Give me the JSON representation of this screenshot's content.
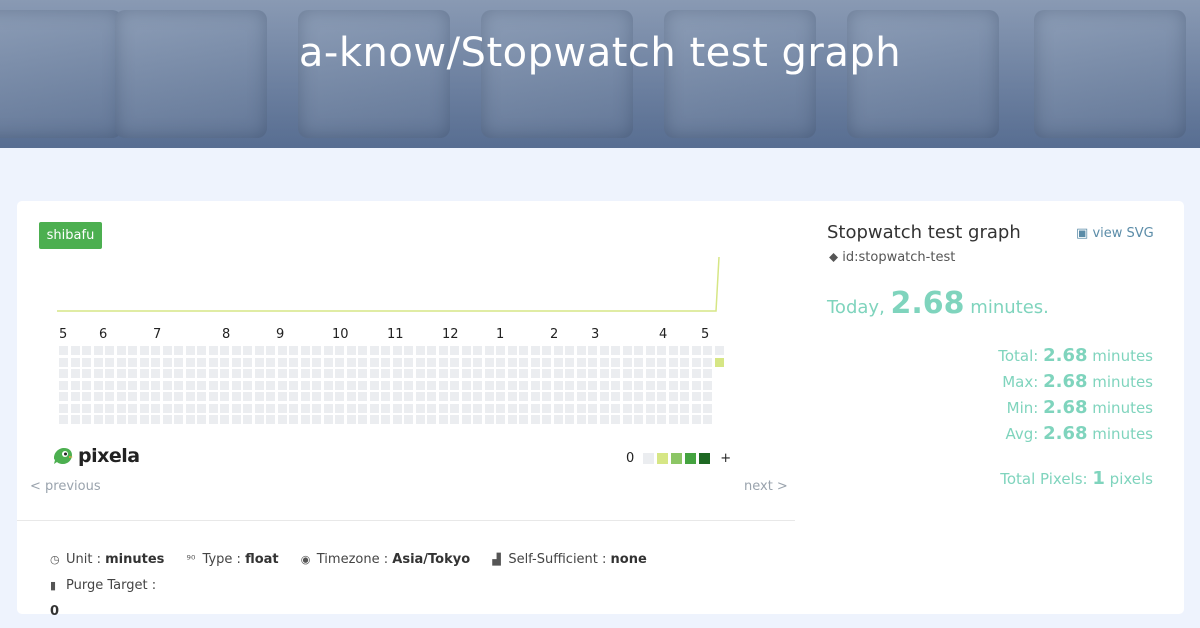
{
  "header": {
    "title": "a-know/Stopwatch test graph"
  },
  "graph": {
    "tag": "shibafu",
    "months": [
      "5",
      "6",
      "7",
      "8",
      "9",
      "10",
      "11",
      "12",
      "1",
      "2",
      "3",
      "4",
      "5"
    ],
    "legend": {
      "min_label": "0",
      "max_label": "+",
      "colors": [
        "#ebedf0",
        "#d6e685",
        "#8cc665",
        "#44a340",
        "#1e6823"
      ]
    },
    "active_color": "#d6e685",
    "logo_text": "pixela"
  },
  "pager": {
    "previous": "< previous",
    "next": "next >"
  },
  "meta": {
    "unit_label": "Unit",
    "unit_value": "minutes",
    "type_label": "Type",
    "type_value": "float",
    "timezone_label": "Timezone",
    "timezone_value": "Asia/Tokyo",
    "selfsufficient_label": "Self-Sufficient",
    "selfsufficient_value": "none",
    "purge_label": "Purge Target",
    "purge_value": "0"
  },
  "sidebar": {
    "title": "Stopwatch test graph",
    "view_svg": "view SVG",
    "graph_id": "id:stopwatch-test",
    "today_label": "Today",
    "today_value": "2.68",
    "today_unit": "minutes.",
    "stats": [
      {
        "label": "Total",
        "value": "2.68",
        "unit": "minutes"
      },
      {
        "label": "Max",
        "value": "2.68",
        "unit": "minutes"
      },
      {
        "label": "Min",
        "value": "2.68",
        "unit": "minutes"
      },
      {
        "label": "Avg",
        "value": "2.68",
        "unit": "minutes"
      }
    ],
    "pixels_label": "Total Pixels",
    "pixels_value": "1",
    "pixels_unit": "pixels"
  },
  "colors": {
    "accent": "#7fd4bd",
    "tag": "#4caf50",
    "link": "#5b8ca8"
  }
}
